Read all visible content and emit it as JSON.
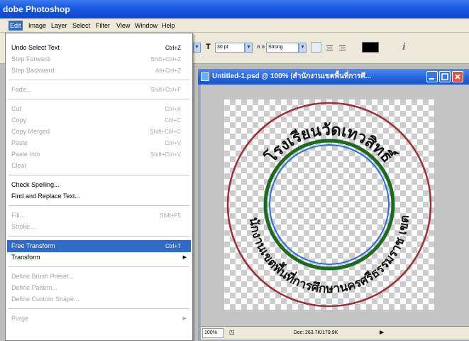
{
  "app": {
    "title": "dobe Photoshop"
  },
  "menubar": [
    "Edit",
    "Image",
    "Layer",
    "Select",
    "Filter",
    "View",
    "Window",
    "Help"
  ],
  "toolbar": {
    "font_size": "30 pt",
    "antialias": "Strong",
    "aa_label": "a a"
  },
  "document": {
    "title": "Untitled-1.psd @ 100% (สำนักงานเขตพื้นที่การศึ...",
    "zoom": "100%",
    "doc_size": "Doc: 263.7K/179.9K"
  },
  "seal": {
    "top_text": "โรงเรียนวัดเทวสิทธิ์",
    "bottom_text": "สำนักงานเขตพื้นที่การศึกษานครศรีธรรมราช เขต ๑",
    "colors": {
      "outer": "#a02c3c",
      "middle": "#1e6a1e",
      "inner": "#2a6ee0"
    }
  },
  "edit_menu": [
    {
      "label": "Undo Select Text",
      "shortcut": "Ctrl+Z",
      "enabled": true
    },
    {
      "label": "Step Forward",
      "shortcut": "Shift+Ctrl+Z",
      "enabled": false
    },
    {
      "label": "Step Backward",
      "shortcut": "Alt+Ctrl+Z",
      "enabled": false
    },
    {
      "label": "Fade...",
      "shortcut": "Shift+Ctrl+F",
      "enabled": false
    },
    {
      "label": "Cut",
      "shortcut": "Ctrl+X",
      "enabled": false
    },
    {
      "label": "Copy",
      "shortcut": "Ctrl+C",
      "enabled": false
    },
    {
      "label": "Copy Merged",
      "shortcut": "Shift+Ctrl+C",
      "enabled": false
    },
    {
      "label": "Paste",
      "shortcut": "Ctrl+V",
      "enabled": false
    },
    {
      "label": "Paste Into",
      "shortcut": "Shift+Ctrl+V",
      "enabled": false
    },
    {
      "label": "Clear",
      "shortcut": "",
      "enabled": false
    },
    {
      "label": "Check Spelling...",
      "shortcut": "",
      "enabled": true
    },
    {
      "label": "Find and Replace Text...",
      "shortcut": "",
      "enabled": true
    },
    {
      "label": "Fill...",
      "shortcut": "Shift+F5",
      "enabled": false
    },
    {
      "label": "Stroke...",
      "shortcut": "",
      "enabled": false
    },
    {
      "label": "Free Transform",
      "shortcut": "Ctrl+T",
      "enabled": true,
      "highlighted": true
    },
    {
      "label": "Transform",
      "shortcut": "",
      "enabled": true,
      "submenu": true
    },
    {
      "label": "Define Brush Preset...",
      "shortcut": "",
      "enabled": false
    },
    {
      "label": "Define Pattern...",
      "shortcut": "",
      "enabled": false
    },
    {
      "label": "Define Custom Shape...",
      "shortcut": "",
      "enabled": false
    },
    {
      "label": "Purge",
      "shortcut": "",
      "enabled": false,
      "submenu": true
    }
  ]
}
